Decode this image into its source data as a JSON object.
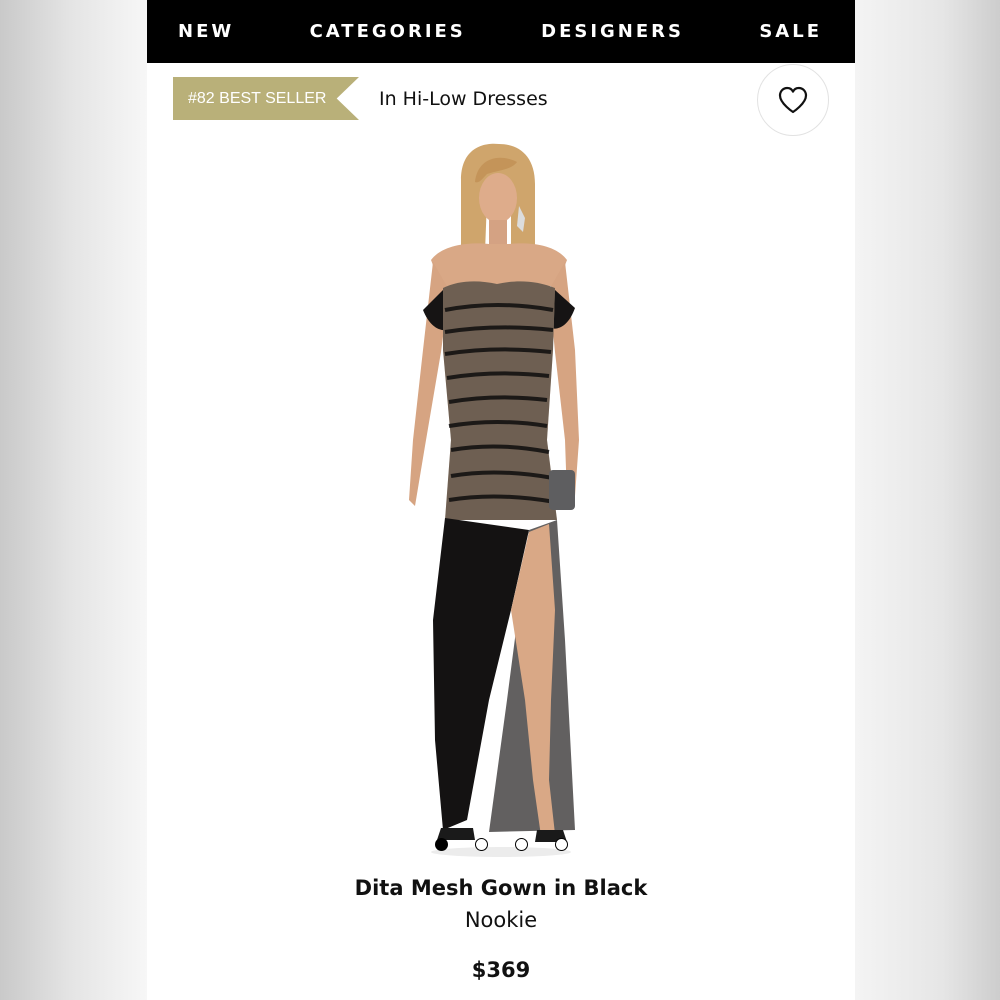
{
  "nav": {
    "items": [
      {
        "label": "NEW"
      },
      {
        "label": "CATEGORIES"
      },
      {
        "label": "DESIGNERS"
      },
      {
        "label": "SALE"
      }
    ]
  },
  "ranking": {
    "badge": "#82 BEST SELLER",
    "category": "In Hi-Low Dresses"
  },
  "favorite": {
    "icon": "heart-icon"
  },
  "gallery": {
    "image_count": 4,
    "active_index": 0
  },
  "product": {
    "name": "Dita Mesh Gown in Black",
    "brand": "Nookie",
    "price": "$369"
  },
  "colors": {
    "nav_bg": "#000000",
    "badge_bg": "#b9b079",
    "dress": "#0e0d0d",
    "skin": "#d9a886",
    "hair": "#cfa56c"
  }
}
